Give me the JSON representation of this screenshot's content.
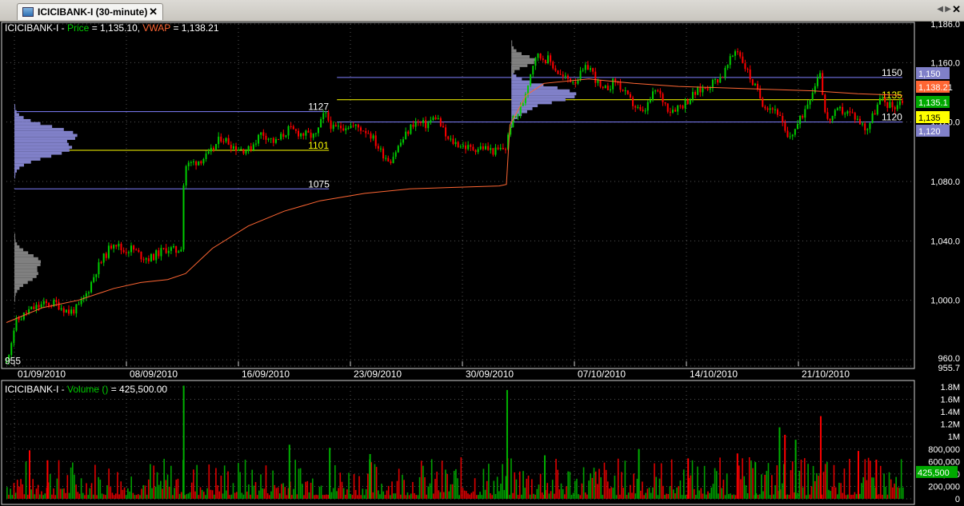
{
  "tab": {
    "title": "ICICIBANK-I (30-minute)",
    "close_glyph": "✕"
  },
  "window": {
    "close_glyph": "✕",
    "left_arrow": "◀",
    "right_arrow": "▶"
  },
  "price_panel": {
    "symbol": "ICICIBANK-I",
    "dash": " - ",
    "price_label": "Price",
    "price_eq": " = 1,135.10, ",
    "vwap_label": "VWAP",
    "vwap_eq": " = 1,138.21",
    "colors": {
      "price": "#00cc00",
      "vwap": "#ff6633",
      "up": "#00cc00",
      "down": "#ff0000",
      "text": "#ffffff"
    }
  },
  "volume_panel": {
    "symbol": "ICICIBANK-I",
    "dash": " - ",
    "volume_label": "Volume",
    "parens": " ()",
    "volume_eq": "   = 425,500.00"
  },
  "chart_data": [
    {
      "type": "candlestick",
      "ylim": [
        955.7,
        1186.0
      ],
      "y_ticks": [
        "1,186.0",
        "1,160.0",
        "1,120.0",
        "1,080.0",
        "1,040.0",
        "1,000.0",
        "960.0",
        "955.7"
      ],
      "x_ticks": [
        "01/09/2010",
        "08/09/2010",
        "16/09/2010",
        "23/09/2010",
        "30/09/2010",
        "07/10/2010",
        "14/10/2010",
        "21/10/2010"
      ],
      "price_tags": [
        {
          "text": "1,150",
          "value": 1150,
          "bg": "#8080c8",
          "fg": "#ffffff"
        },
        {
          "text": "1,138.21",
          "value": 1138.21,
          "bg": "#ff6633",
          "fg": "#ffffff"
        },
        {
          "text": "1,135.1",
          "value": 1135.1,
          "bg": "#00aa00",
          "fg": "#ffffff"
        },
        {
          "text": "1,135",
          "value": 1135,
          "bg": "#ffff00",
          "fg": "#000000"
        },
        {
          "text": "1,120",
          "value": 1120,
          "bg": "#8080c8",
          "fg": "#ffffff"
        }
      ],
      "level_lines": [
        {
          "label": "1127",
          "value": 1127,
          "color": "#8080ff",
          "x0": 0.0,
          "x1": 0.36
        },
        {
          "label": "1101",
          "value": 1101,
          "color": "#ffff00",
          "x0": 0.0,
          "x1": 0.36
        },
        {
          "label": "1075",
          "value": 1075,
          "color": "#8080ff",
          "x0": 0.0,
          "x1": 0.36
        },
        {
          "label": "1150",
          "value": 1150,
          "color": "#8080ff",
          "x0": 0.36,
          "x1": 1.0
        },
        {
          "label": "1135",
          "value": 1135,
          "color": "#ffff00",
          "x0": 0.36,
          "x1": 1.0
        },
        {
          "label": "1120",
          "value": 1120,
          "color": "#8080ff",
          "x0": 0.36,
          "x1": 1.0
        }
      ],
      "low_label": "955",
      "price_path": [
        [
          0.0,
          958
        ],
        [
          0.01,
          985
        ],
        [
          0.025,
          993
        ],
        [
          0.04,
          997
        ],
        [
          0.055,
          998
        ],
        [
          0.07,
          992
        ],
        [
          0.08,
          995
        ],
        [
          0.09,
          1005
        ],
        [
          0.1,
          1020
        ],
        [
          0.11,
          1030
        ],
        [
          0.12,
          1040
        ],
        [
          0.13,
          1033
        ],
        [
          0.14,
          1035
        ],
        [
          0.15,
          1030
        ],
        [
          0.16,
          1028
        ],
        [
          0.17,
          1032
        ],
        [
          0.18,
          1035
        ],
        [
          0.19,
          1033
        ],
        [
          0.197,
          1038
        ],
        [
          0.198,
          1090
        ],
        [
          0.21,
          1093
        ],
        [
          0.225,
          1097
        ],
        [
          0.24,
          1110
        ],
        [
          0.255,
          1103
        ],
        [
          0.27,
          1101
        ],
        [
          0.285,
          1113
        ],
        [
          0.3,
          1106
        ],
        [
          0.315,
          1115
        ],
        [
          0.33,
          1112
        ],
        [
          0.345,
          1110
        ],
        [
          0.355,
          1126
        ],
        [
          0.365,
          1115
        ],
        [
          0.38,
          1118
        ],
        [
          0.395,
          1116
        ],
        [
          0.405,
          1113
        ],
        [
          0.418,
          1100
        ],
        [
          0.428,
          1094
        ],
        [
          0.44,
          1106
        ],
        [
          0.455,
          1120
        ],
        [
          0.468,
          1118
        ],
        [
          0.48,
          1124
        ],
        [
          0.492,
          1108
        ],
        [
          0.505,
          1105
        ],
        [
          0.518,
          1102
        ],
        [
          0.532,
          1103
        ],
        [
          0.545,
          1100
        ],
        [
          0.558,
          1103
        ],
        [
          0.562,
          1118
        ],
        [
          0.575,
          1130
        ],
        [
          0.59,
          1165
        ],
        [
          0.605,
          1162
        ],
        [
          0.62,
          1150
        ],
        [
          0.635,
          1148
        ],
        [
          0.65,
          1158
        ],
        [
          0.665,
          1140
        ],
        [
          0.68,
          1148
        ],
        [
          0.695,
          1135
        ],
        [
          0.71,
          1125
        ],
        [
          0.725,
          1142
        ],
        [
          0.74,
          1128
        ],
        [
          0.755,
          1132
        ],
        [
          0.77,
          1140
        ],
        [
          0.785,
          1145
        ],
        [
          0.8,
          1152
        ],
        [
          0.815,
          1170
        ],
        [
          0.83,
          1150
        ],
        [
          0.845,
          1132
        ],
        [
          0.86,
          1128
        ],
        [
          0.872,
          1108
        ],
        [
          0.885,
          1120
        ],
        [
          0.9,
          1142
        ],
        [
          0.908,
          1155
        ],
        [
          0.915,
          1120
        ],
        [
          0.93,
          1128
        ],
        [
          0.945,
          1125
        ],
        [
          0.96,
          1115
        ],
        [
          0.975,
          1135
        ],
        [
          0.99,
          1130
        ],
        [
          1.0,
          1135
        ]
      ],
      "vwap_path": [
        [
          0.0,
          985
        ],
        [
          0.04,
          995
        ],
        [
          0.08,
          1000
        ],
        [
          0.12,
          1008
        ],
        [
          0.15,
          1012
        ],
        [
          0.18,
          1014
        ],
        [
          0.2,
          1018
        ],
        [
          0.23,
          1035
        ],
        [
          0.27,
          1050
        ],
        [
          0.31,
          1060
        ],
        [
          0.35,
          1067
        ],
        [
          0.4,
          1072
        ],
        [
          0.45,
          1075
        ],
        [
          0.5,
          1076
        ],
        [
          0.55,
          1077
        ],
        [
          0.558,
          1078
        ],
        [
          0.562,
          1118
        ],
        [
          0.58,
          1138
        ],
        [
          0.6,
          1146
        ],
        [
          0.65,
          1149
        ],
        [
          0.7,
          1146
        ],
        [
          0.75,
          1144
        ],
        [
          0.8,
          1143
        ],
        [
          0.85,
          1142
        ],
        [
          0.9,
          1141
        ],
        [
          0.95,
          1139
        ],
        [
          1.0,
          1138
        ]
      ]
    },
    {
      "type": "bar",
      "ylim": [
        0,
        1800000
      ],
      "y_ticks": [
        "1.8M",
        "1.6M",
        "1.4M",
        "1.2M",
        "1M",
        "800,000",
        "600,000",
        "400,000",
        "200,000",
        "0"
      ],
      "last_value": "425,500",
      "seed": 7,
      "spikes": [
        {
          "x": 0.197,
          "v": 1820000,
          "up": true
        },
        {
          "x": 0.558,
          "v": 1750000,
          "up": true
        },
        {
          "x": 0.908,
          "v": 1330000,
          "up": false
        },
        {
          "x": 0.868,
          "v": 1030000,
          "up": false
        },
        {
          "x": 0.862,
          "v": 1150000,
          "up": true
        },
        {
          "x": 0.88,
          "v": 950000,
          "up": true
        },
        {
          "x": 0.025,
          "v": 780000,
          "up": false
        },
        {
          "x": 0.045,
          "v": 620000,
          "up": false
        },
        {
          "x": 0.315,
          "v": 870000,
          "up": true
        },
        {
          "x": 0.36,
          "v": 820000,
          "up": true
        },
        {
          "x": 0.405,
          "v": 720000,
          "up": true
        },
        {
          "x": 0.6,
          "v": 700000,
          "up": true
        },
        {
          "x": 0.705,
          "v": 800000,
          "up": true
        },
        {
          "x": 0.76,
          "v": 650000,
          "up": false
        },
        {
          "x": 0.815,
          "v": 730000,
          "up": false
        },
        {
          "x": 0.835,
          "v": 590000,
          "up": true
        },
        {
          "x": 0.95,
          "v": 770000,
          "up": false
        },
        {
          "x": 0.97,
          "v": 630000,
          "up": false
        }
      ]
    }
  ]
}
